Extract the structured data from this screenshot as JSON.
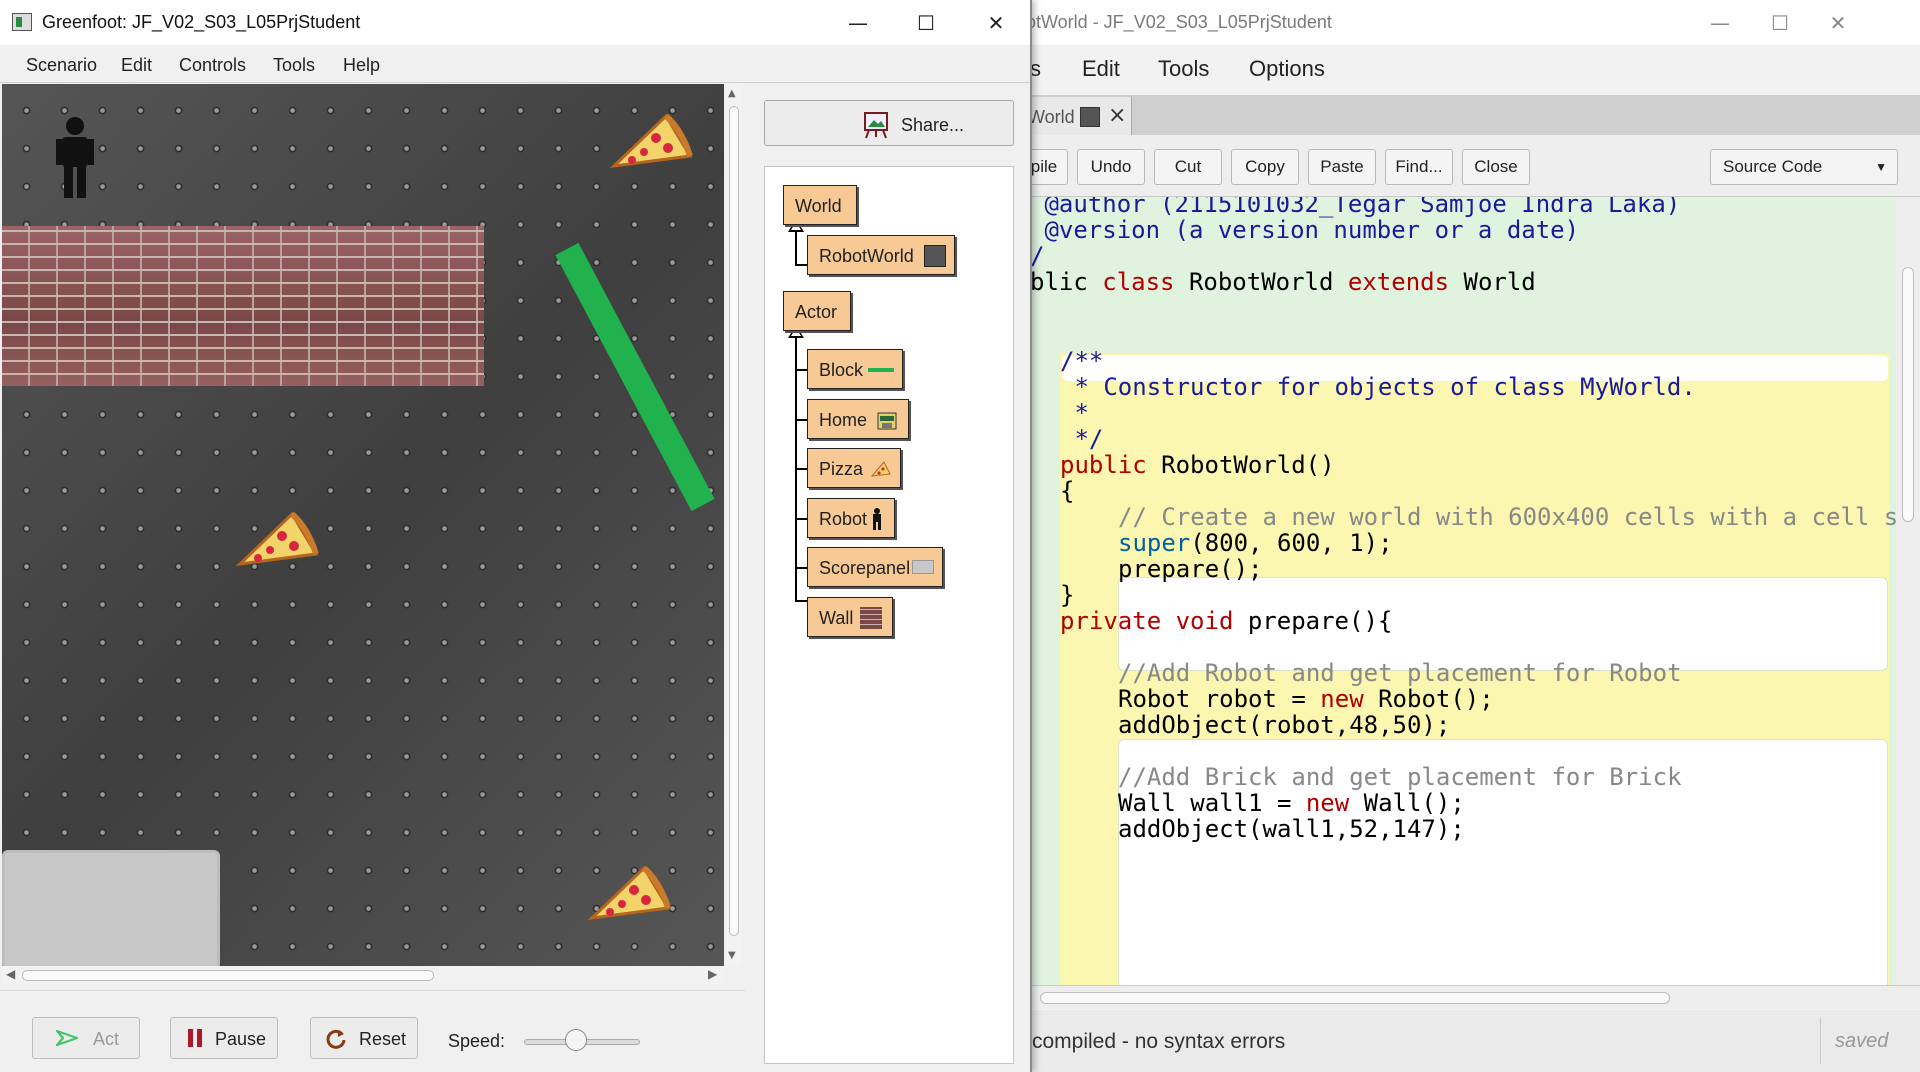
{
  "editor": {
    "title": "otWorld - JF_V02_S03_L05PrjStudent",
    "menu": [
      "s",
      "Edit",
      "Tools",
      "Options"
    ],
    "tab": {
      "label": "World",
      "close": "×"
    },
    "toolbar": [
      "pile",
      "Undo",
      "Cut",
      "Copy",
      "Paste",
      "Find...",
      "Close"
    ],
    "view_select": "Source Code",
    "code": {
      "l1": " @author (2115101032_Tegar Samjoe Indra Laka)",
      "l2": " @version (a version number or a date)",
      "l3": "/",
      "l4_a": "blic ",
      "l4_kw1": "class",
      "l4_b": " RobotWorld ",
      "l4_kw2": "extends",
      "l4_c": " World",
      "l5": "/**",
      "l6": " * Constructor for objects of class MyWorld.",
      "l7": " *",
      "l8": " */",
      "l9_kw": "public",
      "l9_b": " RobotWorld()",
      "l10": "{",
      "l11": "// Create a new world with 600x400 cells with a cell s",
      "l12_kw": "super",
      "l12_b": "(800, 600, 1);",
      "l13": "prepare();",
      "l14": "}",
      "l15_kw1": "private",
      "l15_kw2": "void",
      "l15_b": " prepare(){",
      "l16": "//Add Robot and get placement for Robot",
      "l17_a": "Robot robot = ",
      "l17_kw": "new",
      "l17_b": " Robot();",
      "l18": "addObject(robot,48,50);",
      "l19": "//Add Brick and get placement for Brick",
      "l20_a": "Wall wall1 = ",
      "l20_kw": "new",
      "l20_b": " Wall();",
      "l21": "addObject(wall1,52,147);"
    },
    "status": "compiled - no syntax errors",
    "saved": "saved"
  },
  "greenfoot": {
    "title": "Greenfoot: JF_V02_S03_L05PrjStudent",
    "menu": [
      "Scenario",
      "Edit",
      "Controls",
      "Tools",
      "Help"
    ],
    "controls": {
      "act": "Act",
      "pause": "Pause",
      "reset": "Reset",
      "speed": "Speed:",
      "speed_level": 0.45
    },
    "share": "Share...",
    "classes": {
      "world": "World",
      "robotworld": "RobotWorld",
      "actor": "Actor",
      "block": "Block",
      "home": "Home",
      "pizza": "Pizza",
      "robot": "Robot",
      "scorepanel": "Scorepanel",
      "wall": "Wall"
    }
  },
  "colors": {
    "class_box": "#f7c995",
    "block_green": "#21b24e",
    "code_bg": "#dff3df",
    "method_bg": "#fbf6b0"
  }
}
